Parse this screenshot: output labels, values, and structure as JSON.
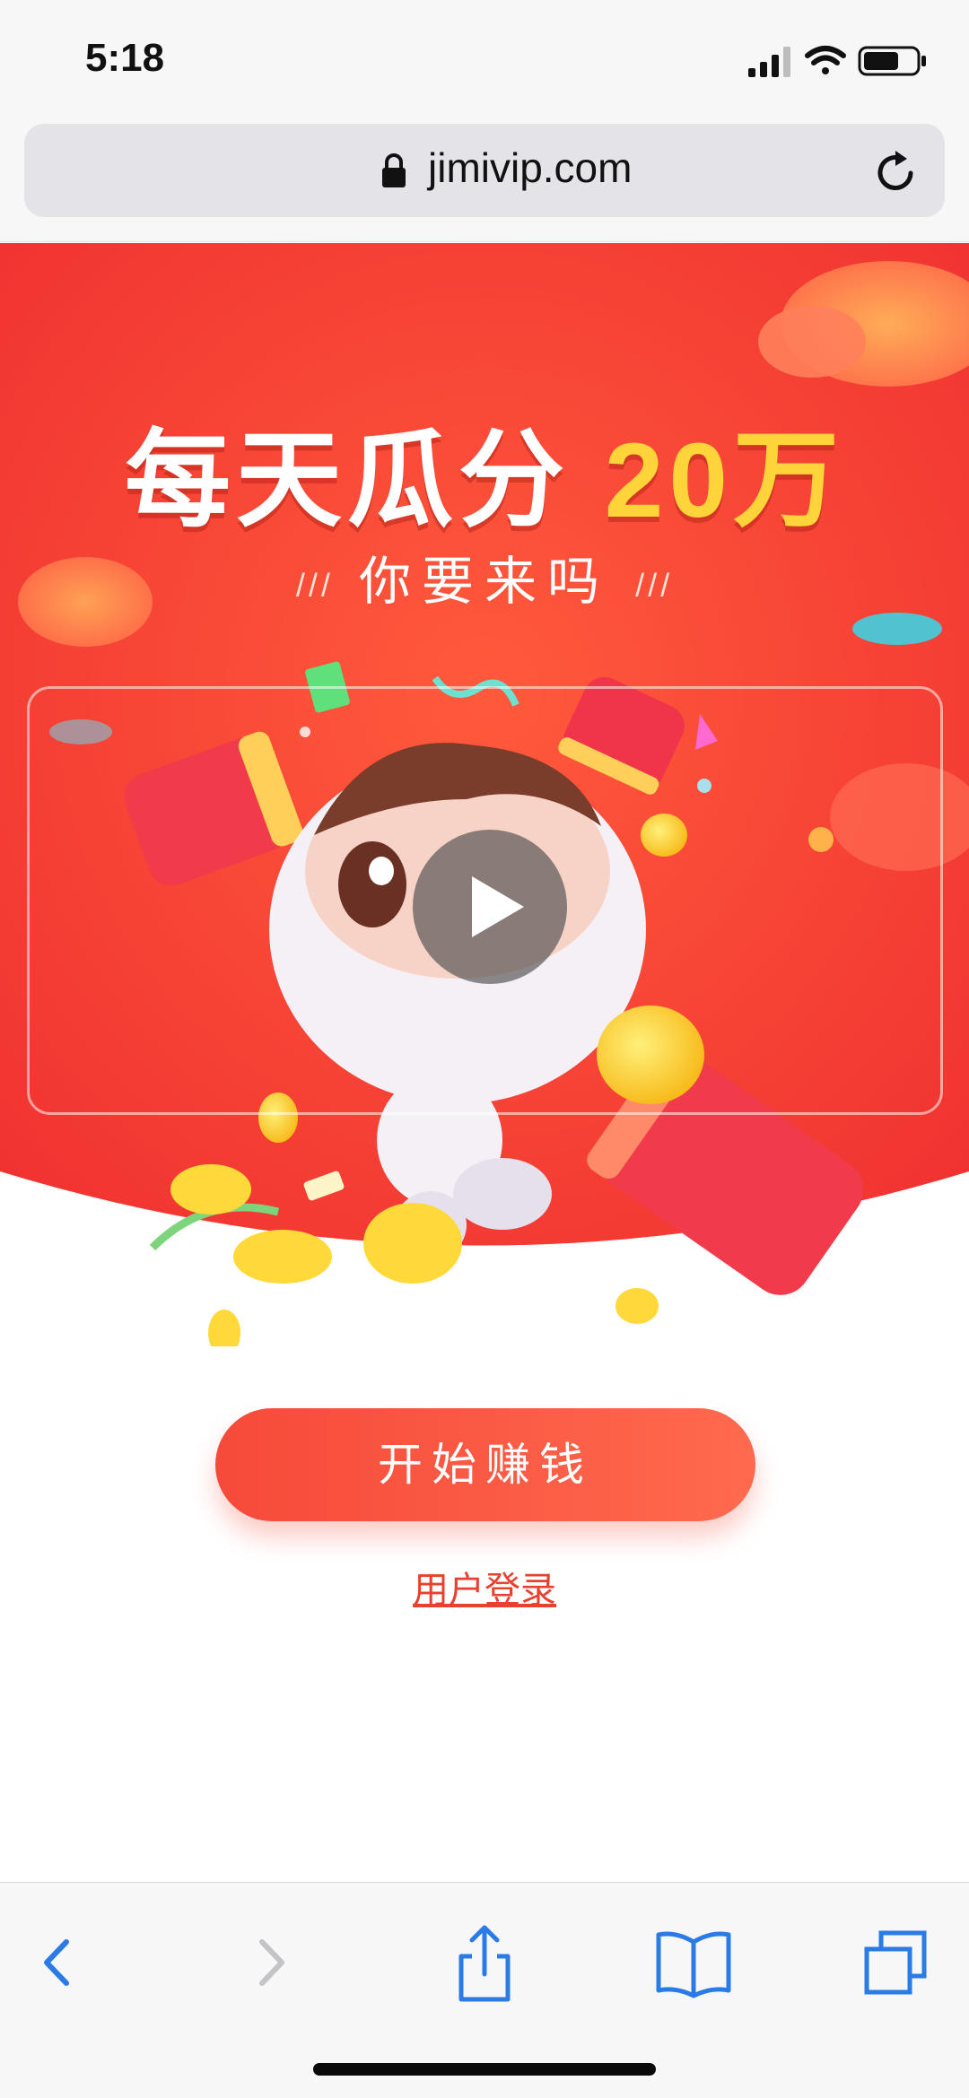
{
  "status_bar": {
    "time": "5:18"
  },
  "browser": {
    "url": "jimivip.com"
  },
  "hero": {
    "title_main": "每天瓜分",
    "title_amount": "20万",
    "subtitle": "你要来吗",
    "subtitle_deco": "///"
  },
  "actions": {
    "start_label": "开始赚钱",
    "login_label": "用户登录"
  },
  "colors": {
    "hero_red": "#f23a32",
    "accent_yellow": "#ffd43b",
    "cta_red": "#f64a3a",
    "ios_blue": "#2a7be6"
  },
  "icons": [
    "lock-icon",
    "reload-icon",
    "play-icon",
    "back-icon",
    "forward-icon",
    "share-icon",
    "bookmarks-icon",
    "tabs-icon"
  ]
}
